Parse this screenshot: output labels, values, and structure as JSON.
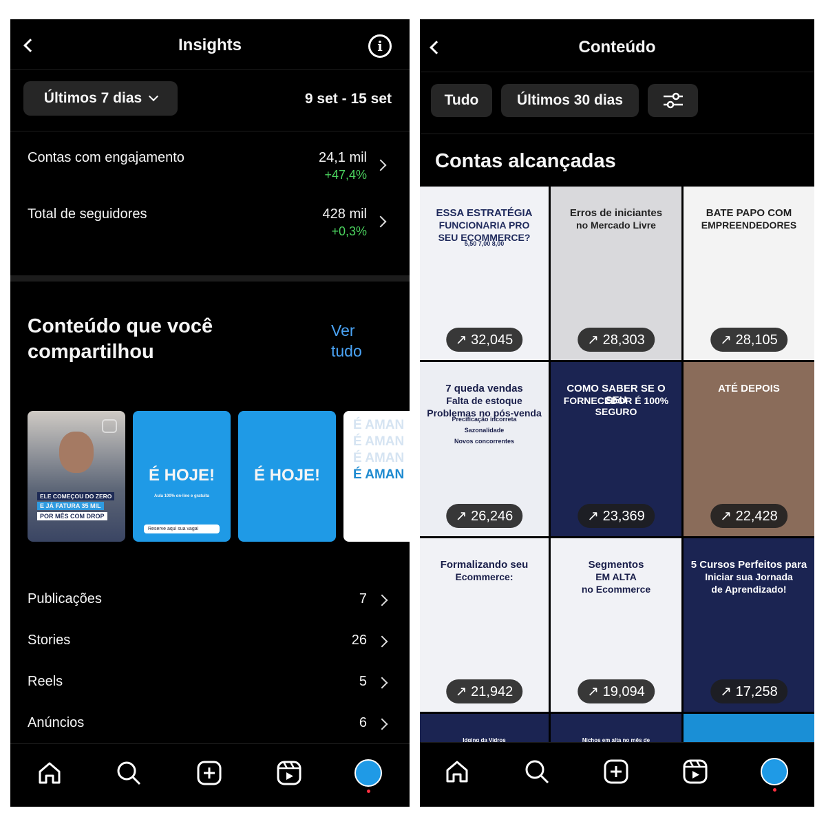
{
  "left": {
    "header": {
      "title": "Insights",
      "back_icon": "chevron-left-icon",
      "info_icon": "info-icon"
    },
    "filter": {
      "period": "Últimos 7 dias",
      "date_range": "9 set - 15 set"
    },
    "metrics": [
      {
        "label": "Contas com engajamento",
        "value": "24,1 mil",
        "change": "+47,4%"
      },
      {
        "label": "Total de seguidores",
        "value": "428 mil",
        "change": "+0,3%"
      }
    ],
    "content_section": {
      "title": "Conteúdo que você compartilhou",
      "see_all": "Ver tudo"
    },
    "thumbnails": [
      {
        "lines": [
          "ELE COMEÇOU DO ZERO",
          "E JÁ FATURA 35 MIL",
          "POR MÊS COM DROP"
        ],
        "type": "reel"
      },
      {
        "headline": "É HOJE!",
        "subtitle": "Aula 100% on-line e gratuita",
        "button": "Reserve aqui sua vaga!"
      },
      {
        "headline": "É HOJE!"
      },
      {
        "lines": [
          "É AMAN",
          "É AMAN",
          "É AMAN",
          "É AMAN"
        ]
      }
    ],
    "list": [
      {
        "label": "Publicações",
        "value": "7"
      },
      {
        "label": "Stories",
        "value": "26"
      },
      {
        "label": "Reels",
        "value": "5"
      },
      {
        "label": "Anúncios",
        "value": "6"
      }
    ]
  },
  "right": {
    "header": {
      "title": "Conteúdo"
    },
    "chips": {
      "type": "Tudo",
      "period": "Últimos 30 dias",
      "filter_icon": "sliders-icon"
    },
    "section_title": "Contas alcançadas",
    "grid": [
      {
        "lines": [
          "ESSA ESTRATÉGIA",
          "FUNCIONARIA PRO",
          "SEU ECOMMERCE?",
          "5,50  7,00  8,00"
        ],
        "reach": "32,045",
        "bg": "#f1f2f6",
        "fg": "#1f2a5c"
      },
      {
        "lines": [
          "Erros de iniciantes",
          "no Mercado Livre"
        ],
        "reach": "28,303",
        "bg": "#d9d9dc",
        "fg": "#222"
      },
      {
        "lines": [
          "BATE PAPO COM",
          "EMPREENDEDORES"
        ],
        "reach": "28,105",
        "bg": "#f3f3f3",
        "fg": "#222"
      },
      {
        "lines": [
          "7 queda vendas",
          "Falta de estoque",
          "Problemas no pós-venda",
          "Precificação incorreta",
          "Sazonalidade",
          "Novos concorrentes"
        ],
        "reach": "26,246",
        "bg": "#eceef3",
        "fg": "#1a1f4a"
      },
      {
        "lines": [
          "COMO SABER SE O SEU",
          "FORNECEDOR É 100% SEGURO"
        ],
        "reach": "23,369",
        "bg": "#1b2452",
        "fg": "#fff"
      },
      {
        "lines": [
          "ATÉ DEPOIS"
        ],
        "reach": "22,428",
        "bg": "#8a6c5a",
        "fg": "#fff"
      },
      {
        "lines": [
          "Formalizando seu",
          "Ecommerce:"
        ],
        "reach": "21,942",
        "bg": "#f1f2f6",
        "fg": "#1a1f4a"
      },
      {
        "lines": [
          "Segmentos",
          "EM ALTA",
          "no Ecommerce"
        ],
        "reach": "19,094",
        "bg": "#f1f2f6",
        "fg": "#1a1f4a"
      },
      {
        "lines": [
          "5 Cursos Perfeitos para",
          "Iniciar sua Jornada",
          "de Aprendizado!"
        ],
        "reach": "17,258",
        "bg": "#1b2452",
        "fg": "#fff"
      },
      {
        "lines": [
          "Idging da Vidros"
        ],
        "bg": "#1b2452",
        "fg": "#fff"
      },
      {
        "lines": [
          "Nichos em alta no mês de"
        ],
        "bg": "#1b2452",
        "fg": "#fff"
      },
      {
        "lines": [
          ""
        ],
        "bg": "#1a8fd6",
        "fg": "#fff"
      }
    ]
  },
  "nav": {
    "items": [
      "home-icon",
      "search-icon",
      "create-icon",
      "reels-icon",
      "profile-avatar"
    ]
  },
  "colors": {
    "green": "#4bd25e",
    "link": "#4aa3f5",
    "chip": "#262626",
    "notification": "#ff3040"
  }
}
